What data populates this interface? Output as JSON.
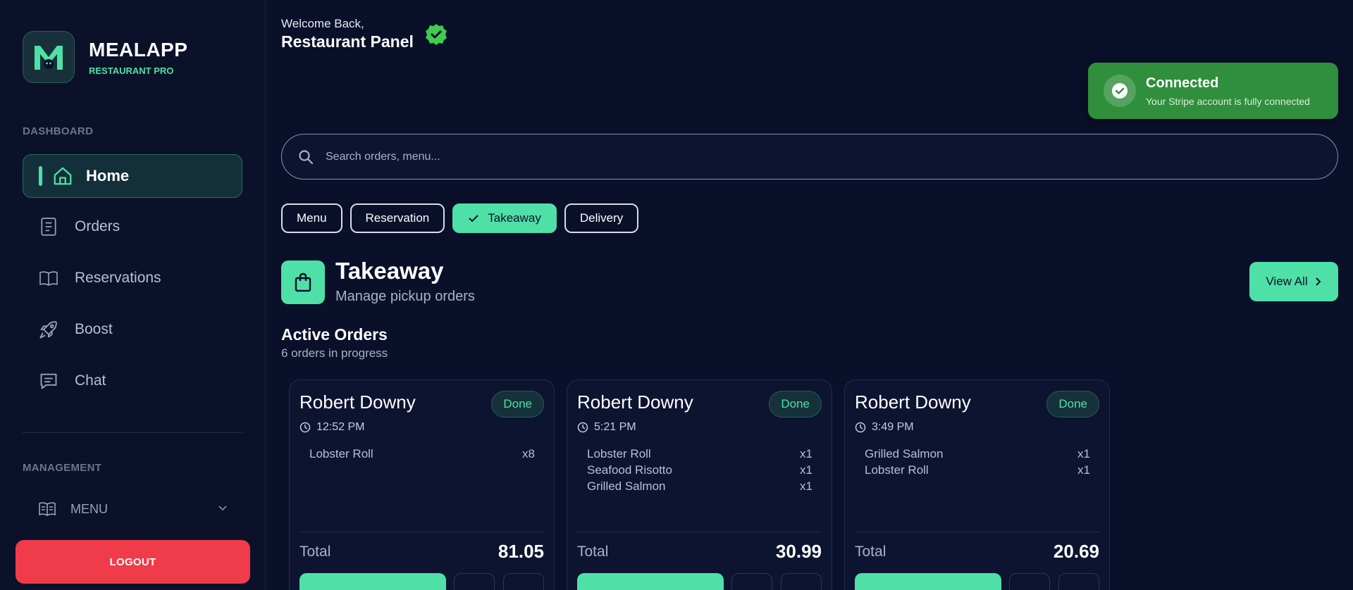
{
  "brand": {
    "name": "MEALAPP",
    "subtitle": "RESTAURANT PRO"
  },
  "sidebar": {
    "dashboard_label": "DASHBOARD",
    "items": [
      {
        "label": "Home",
        "icon": "home-icon",
        "active": true
      },
      {
        "label": "Orders",
        "icon": "receipt-icon"
      },
      {
        "label": "Reservations",
        "icon": "book-icon"
      },
      {
        "label": "Boost",
        "icon": "rocket-icon"
      },
      {
        "label": "Chat",
        "icon": "chat-icon"
      }
    ],
    "management_label": "MANAGEMENT",
    "menu_label": "MENU",
    "logout_label": "LOGOUT"
  },
  "header": {
    "welcome": "Welcome Back,",
    "title": "Restaurant Panel"
  },
  "toast": {
    "title": "Connected",
    "message": "Your Stripe account is fully connected"
  },
  "search": {
    "placeholder": "Search orders, menu..."
  },
  "filters": [
    {
      "label": "Menu",
      "active": false
    },
    {
      "label": "Reservation",
      "active": false
    },
    {
      "label": "Takeaway",
      "active": true
    },
    {
      "label": "Delivery",
      "active": false
    }
  ],
  "section": {
    "title": "Takeaway",
    "subtitle": "Manage pickup orders",
    "view_all": "View All"
  },
  "orders": {
    "title": "Active Orders",
    "subtitle": "6 orders in progress",
    "total_label": "Total",
    "cards": [
      {
        "name": "Robert Downy",
        "status": "Done",
        "time": "12:52 PM",
        "items": [
          {
            "name": "Lobster Roll",
            "qty": "x8"
          }
        ],
        "total": "81.05"
      },
      {
        "name": "Robert Downy",
        "status": "Done",
        "time": "5:21 PM",
        "items": [
          {
            "name": "Lobster Roll",
            "qty": "x1"
          },
          {
            "name": "Seafood Risotto",
            "qty": "x1"
          },
          {
            "name": "Grilled Salmon",
            "qty": "x1"
          }
        ],
        "total": "30.99"
      },
      {
        "name": "Robert Downy",
        "status": "Done",
        "time": "3:49 PM",
        "items": [
          {
            "name": "Grilled Salmon",
            "qty": "x1"
          },
          {
            "name": "Lobster Roll",
            "qty": "x1"
          }
        ],
        "total": "20.69"
      }
    ]
  },
  "colors": {
    "accent": "#4fe0a8",
    "background": "#0a1029",
    "danger": "#ef3b4a",
    "success": "#2f8f3c"
  }
}
